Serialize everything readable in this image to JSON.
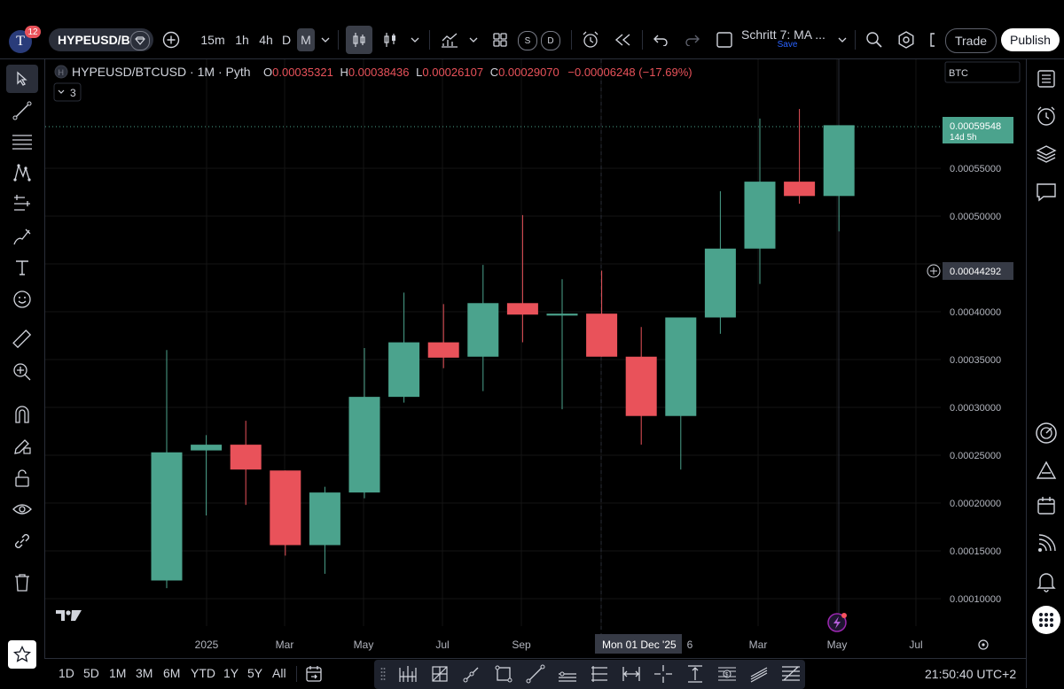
{
  "app": {
    "logo_text": "T",
    "notification_badge": "12",
    "symbol": "HYPEUSD/B",
    "intervals": [
      "15m",
      "1h",
      "4h",
      "D",
      "M"
    ],
    "layout_name": "Schritt 7: MA ...",
    "layout_status": "Save",
    "trade_label": "Trade",
    "publish_label": "Publish"
  },
  "legend": {
    "symbol_full": "HYPEUSD/BTCUSD",
    "interval": "1M",
    "source": "Pyth",
    "o_label": "O",
    "o_value": "0.00035321",
    "h_label": "H",
    "h_value": "0.00038436",
    "l_label": "L",
    "l_value": "0.00026107",
    "c_label": "C",
    "c_value": "0.00029070",
    "change": "−0.00006248 (−17.69%)",
    "indicators_count": "3",
    "compare_value": "BTC"
  },
  "price_axis": {
    "current_price": "0.00059548",
    "countdown": "14d 5h",
    "crosshair_price": "0.00044292"
  },
  "time_axis": {
    "crosshair_date": "Mon 01 Dec '25"
  },
  "bottom": {
    "ranges": [
      "1D",
      "5D",
      "1M",
      "3M",
      "6M",
      "YTD",
      "1Y",
      "5Y",
      "All"
    ],
    "clock": "21:50:40 UTC+2"
  },
  "colors": {
    "bull": "#4ba38d",
    "bear": "#e9525a",
    "background": "#000000",
    "grid": "#141414",
    "accent_button": "#ffffff"
  },
  "chart_data": {
    "type": "candlestick",
    "interval": "1M",
    "y_ticks": [
      0.0001,
      0.00015,
      0.0002,
      0.00025,
      0.0003,
      0.00035,
      0.0004,
      0.00045,
      0.0005,
      0.00055
    ],
    "y_tick_labels": [
      "0.00010000",
      "0.00015000",
      "0.00020000",
      "0.00025000",
      "0.00030000",
      "0.00035000",
      "0.00040000",
      "",
      "0.00050000",
      "0.00055000"
    ],
    "x_tick_labels": [
      "2025",
      "Mar",
      "May",
      "Jul",
      "Sep",
      "",
      "Mar",
      "May",
      "Jul"
    ],
    "candles": [
      {
        "o": 0.000119,
        "h": 0.00036,
        "l": 0.000111,
        "c": 0.000253
      },
      {
        "o": 0.000255,
        "h": 0.000271,
        "l": 0.000187,
        "c": 0.000261
      },
      {
        "o": 0.000261,
        "h": 0.000286,
        "l": 0.000198,
        "c": 0.000235
      },
      {
        "o": 0.000234,
        "h": 0.000234,
        "l": 0.000145,
        "c": 0.000156
      },
      {
        "o": 0.000156,
        "h": 0.000217,
        "l": 0.000126,
        "c": 0.000211
      },
      {
        "o": 0.000211,
        "h": 0.000362,
        "l": 0.000205,
        "c": 0.000311
      },
      {
        "o": 0.000311,
        "h": 0.00042,
        "l": 0.000305,
        "c": 0.000368
      },
      {
        "o": 0.000368,
        "h": 0.000408,
        "l": 0.000341,
        "c": 0.000352
      },
      {
        "o": 0.000353,
        "h": 0.000449,
        "l": 0.000317,
        "c": 0.000409
      },
      {
        "o": 0.000409,
        "h": 0.000501,
        "l": 0.000368,
        "c": 0.000397
      },
      {
        "o": 0.000396,
        "h": 0.000434,
        "l": 0.000298,
        "c": 0.000398
      },
      {
        "o": 0.000398,
        "h": 0.000443,
        "l": 0.000353,
        "c": 0.000353
      },
      {
        "o": 0.000353,
        "h": 0.000384,
        "l": 0.000261,
        "c": 0.000291
      },
      {
        "o": 0.000291,
        "h": 0.000295,
        "l": 0.000235,
        "c": 0.000394
      },
      {
        "o": 0.000394,
        "h": 0.000526,
        "l": 0.000377,
        "c": 0.000466
      },
      {
        "o": 0.000466,
        "h": 0.000602,
        "l": 0.000429,
        "c": 0.000536
      },
      {
        "o": 0.000536,
        "h": 0.000612,
        "l": 0.000513,
        "c": 0.000521
      },
      {
        "o": 0.000521,
        "h": 0.000595,
        "l": 0.000484,
        "c": 0.000595
      }
    ]
  }
}
